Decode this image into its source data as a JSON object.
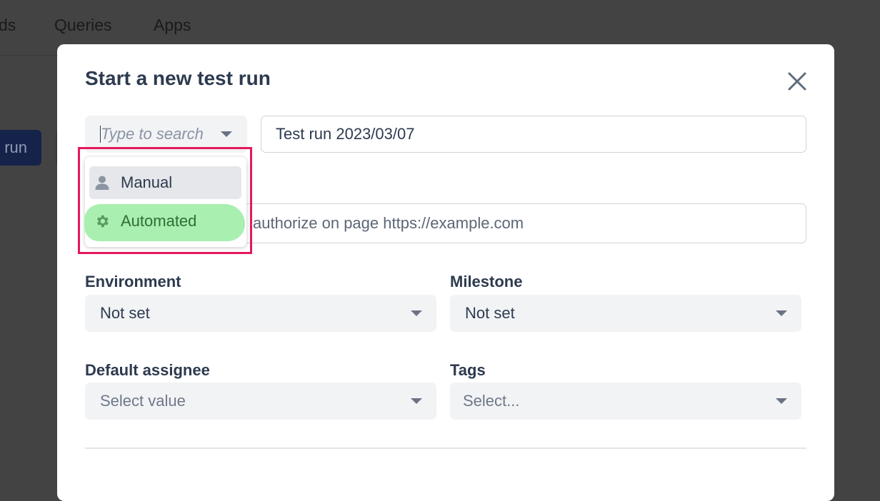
{
  "background_nav": {
    "items": [
      "ds",
      "Queries",
      "Apps"
    ],
    "run_button_label": "run"
  },
  "modal": {
    "title": "Start a new test run",
    "type_select": {
      "placeholder": "Type to search"
    },
    "run_name": {
      "value": "Test run 2023/03/07"
    },
    "description": {
      "value_visible": "authorize on page https://example.com"
    },
    "environment": {
      "label": "Environment",
      "value": "Not set"
    },
    "milestone": {
      "label": "Milestone",
      "value": "Not set"
    },
    "default_assignee": {
      "label": "Default assignee",
      "placeholder": "Select value"
    },
    "tags": {
      "label": "Tags",
      "placeholder": "Select..."
    }
  },
  "dropdown": {
    "options": [
      {
        "label": "Manual",
        "icon": "person-icon",
        "state": "hovered"
      },
      {
        "label": "Automated",
        "icon": "gear-icon",
        "state": "highlighted"
      }
    ]
  },
  "colors": {
    "annotation_box": "#e4195b",
    "highlight": "#a9efb0",
    "modal_title": "#2d3a4f"
  }
}
